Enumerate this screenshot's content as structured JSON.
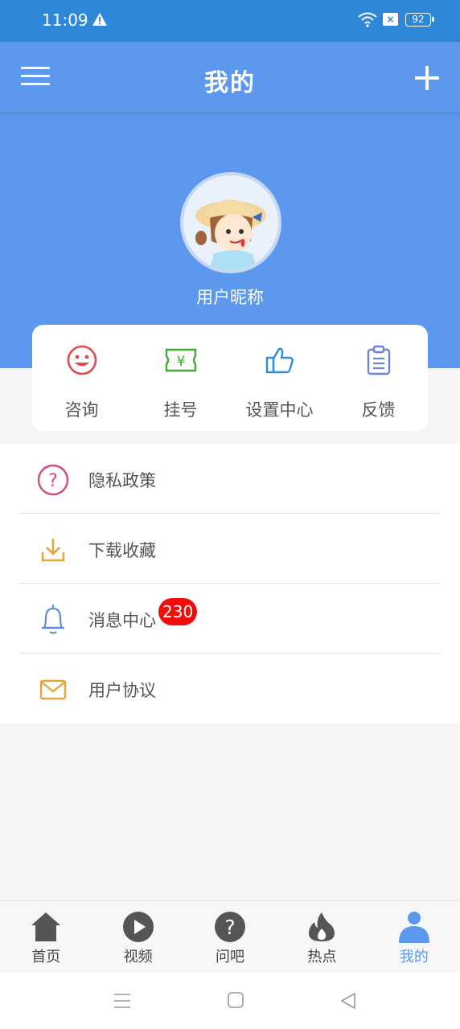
{
  "status_bar": {
    "time": "11:09",
    "battery": "92"
  },
  "header": {
    "title": "我的"
  },
  "profile": {
    "nickname": "用户昵称"
  },
  "quick_actions": [
    {
      "label": "咨询",
      "icon": "smiley-icon",
      "color": "#e04a4a"
    },
    {
      "label": "挂号",
      "icon": "yen-ticket-icon",
      "color": "#43a835"
    },
    {
      "label": "设置中心",
      "icon": "thumbs-up-icon",
      "color": "#2e8fd8"
    },
    {
      "label": "反馈",
      "icon": "clipboard-icon",
      "color": "#6c83d6"
    }
  ],
  "menu_list": [
    {
      "label": "隐私政策",
      "icon": "question-circle-icon",
      "color": "#d64a7a"
    },
    {
      "label": "下载收藏",
      "icon": "download-icon",
      "color": "#e8a33a"
    },
    {
      "label": "消息中心",
      "icon": "bell-icon",
      "color": "#5b8fd8",
      "badge": "230"
    },
    {
      "label": "用户协议",
      "icon": "mail-icon",
      "color": "#e8a33a"
    }
  ],
  "bottom_nav": [
    {
      "label": "首页",
      "icon": "home-icon"
    },
    {
      "label": "视频",
      "icon": "play-icon"
    },
    {
      "label": "问吧",
      "icon": "question-icon"
    },
    {
      "label": "热点",
      "icon": "flame-icon"
    },
    {
      "label": "我的",
      "icon": "person-icon",
      "active": true
    }
  ],
  "colors": {
    "status_bar": "#2f87d8",
    "primary": "#5b98ee",
    "badge": "#f20d0d"
  }
}
